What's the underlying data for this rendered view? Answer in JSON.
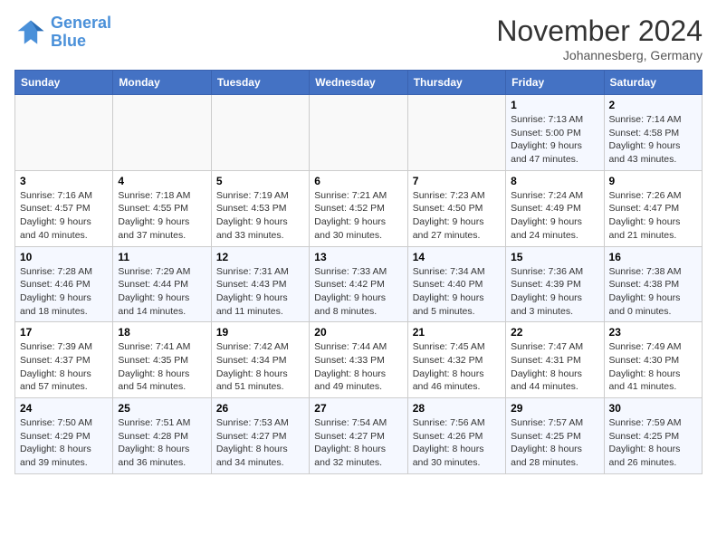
{
  "logo": {
    "line1": "General",
    "line2": "Blue"
  },
  "title": "November 2024",
  "subtitle": "Johannesberg, Germany",
  "days_of_week": [
    "Sunday",
    "Monday",
    "Tuesday",
    "Wednesday",
    "Thursday",
    "Friday",
    "Saturday"
  ],
  "weeks": [
    [
      {
        "day": "",
        "info": ""
      },
      {
        "day": "",
        "info": ""
      },
      {
        "day": "",
        "info": ""
      },
      {
        "day": "",
        "info": ""
      },
      {
        "day": "",
        "info": ""
      },
      {
        "day": "1",
        "info": "Sunrise: 7:13 AM\nSunset: 5:00 PM\nDaylight: 9 hours and 47 minutes."
      },
      {
        "day": "2",
        "info": "Sunrise: 7:14 AM\nSunset: 4:58 PM\nDaylight: 9 hours and 43 minutes."
      }
    ],
    [
      {
        "day": "3",
        "info": "Sunrise: 7:16 AM\nSunset: 4:57 PM\nDaylight: 9 hours and 40 minutes."
      },
      {
        "day": "4",
        "info": "Sunrise: 7:18 AM\nSunset: 4:55 PM\nDaylight: 9 hours and 37 minutes."
      },
      {
        "day": "5",
        "info": "Sunrise: 7:19 AM\nSunset: 4:53 PM\nDaylight: 9 hours and 33 minutes."
      },
      {
        "day": "6",
        "info": "Sunrise: 7:21 AM\nSunset: 4:52 PM\nDaylight: 9 hours and 30 minutes."
      },
      {
        "day": "7",
        "info": "Sunrise: 7:23 AM\nSunset: 4:50 PM\nDaylight: 9 hours and 27 minutes."
      },
      {
        "day": "8",
        "info": "Sunrise: 7:24 AM\nSunset: 4:49 PM\nDaylight: 9 hours and 24 minutes."
      },
      {
        "day": "9",
        "info": "Sunrise: 7:26 AM\nSunset: 4:47 PM\nDaylight: 9 hours and 21 minutes."
      }
    ],
    [
      {
        "day": "10",
        "info": "Sunrise: 7:28 AM\nSunset: 4:46 PM\nDaylight: 9 hours and 18 minutes."
      },
      {
        "day": "11",
        "info": "Sunrise: 7:29 AM\nSunset: 4:44 PM\nDaylight: 9 hours and 14 minutes."
      },
      {
        "day": "12",
        "info": "Sunrise: 7:31 AM\nSunset: 4:43 PM\nDaylight: 9 hours and 11 minutes."
      },
      {
        "day": "13",
        "info": "Sunrise: 7:33 AM\nSunset: 4:42 PM\nDaylight: 9 hours and 8 minutes."
      },
      {
        "day": "14",
        "info": "Sunrise: 7:34 AM\nSunset: 4:40 PM\nDaylight: 9 hours and 5 minutes."
      },
      {
        "day": "15",
        "info": "Sunrise: 7:36 AM\nSunset: 4:39 PM\nDaylight: 9 hours and 3 minutes."
      },
      {
        "day": "16",
        "info": "Sunrise: 7:38 AM\nSunset: 4:38 PM\nDaylight: 9 hours and 0 minutes."
      }
    ],
    [
      {
        "day": "17",
        "info": "Sunrise: 7:39 AM\nSunset: 4:37 PM\nDaylight: 8 hours and 57 minutes."
      },
      {
        "day": "18",
        "info": "Sunrise: 7:41 AM\nSunset: 4:35 PM\nDaylight: 8 hours and 54 minutes."
      },
      {
        "day": "19",
        "info": "Sunrise: 7:42 AM\nSunset: 4:34 PM\nDaylight: 8 hours and 51 minutes."
      },
      {
        "day": "20",
        "info": "Sunrise: 7:44 AM\nSunset: 4:33 PM\nDaylight: 8 hours and 49 minutes."
      },
      {
        "day": "21",
        "info": "Sunrise: 7:45 AM\nSunset: 4:32 PM\nDaylight: 8 hours and 46 minutes."
      },
      {
        "day": "22",
        "info": "Sunrise: 7:47 AM\nSunset: 4:31 PM\nDaylight: 8 hours and 44 minutes."
      },
      {
        "day": "23",
        "info": "Sunrise: 7:49 AM\nSunset: 4:30 PM\nDaylight: 8 hours and 41 minutes."
      }
    ],
    [
      {
        "day": "24",
        "info": "Sunrise: 7:50 AM\nSunset: 4:29 PM\nDaylight: 8 hours and 39 minutes."
      },
      {
        "day": "25",
        "info": "Sunrise: 7:51 AM\nSunset: 4:28 PM\nDaylight: 8 hours and 36 minutes."
      },
      {
        "day": "26",
        "info": "Sunrise: 7:53 AM\nSunset: 4:27 PM\nDaylight: 8 hours and 34 minutes."
      },
      {
        "day": "27",
        "info": "Sunrise: 7:54 AM\nSunset: 4:27 PM\nDaylight: 8 hours and 32 minutes."
      },
      {
        "day": "28",
        "info": "Sunrise: 7:56 AM\nSunset: 4:26 PM\nDaylight: 8 hours and 30 minutes."
      },
      {
        "day": "29",
        "info": "Sunrise: 7:57 AM\nSunset: 4:25 PM\nDaylight: 8 hours and 28 minutes."
      },
      {
        "day": "30",
        "info": "Sunrise: 7:59 AM\nSunset: 4:25 PM\nDaylight: 8 hours and 26 minutes."
      }
    ]
  ]
}
